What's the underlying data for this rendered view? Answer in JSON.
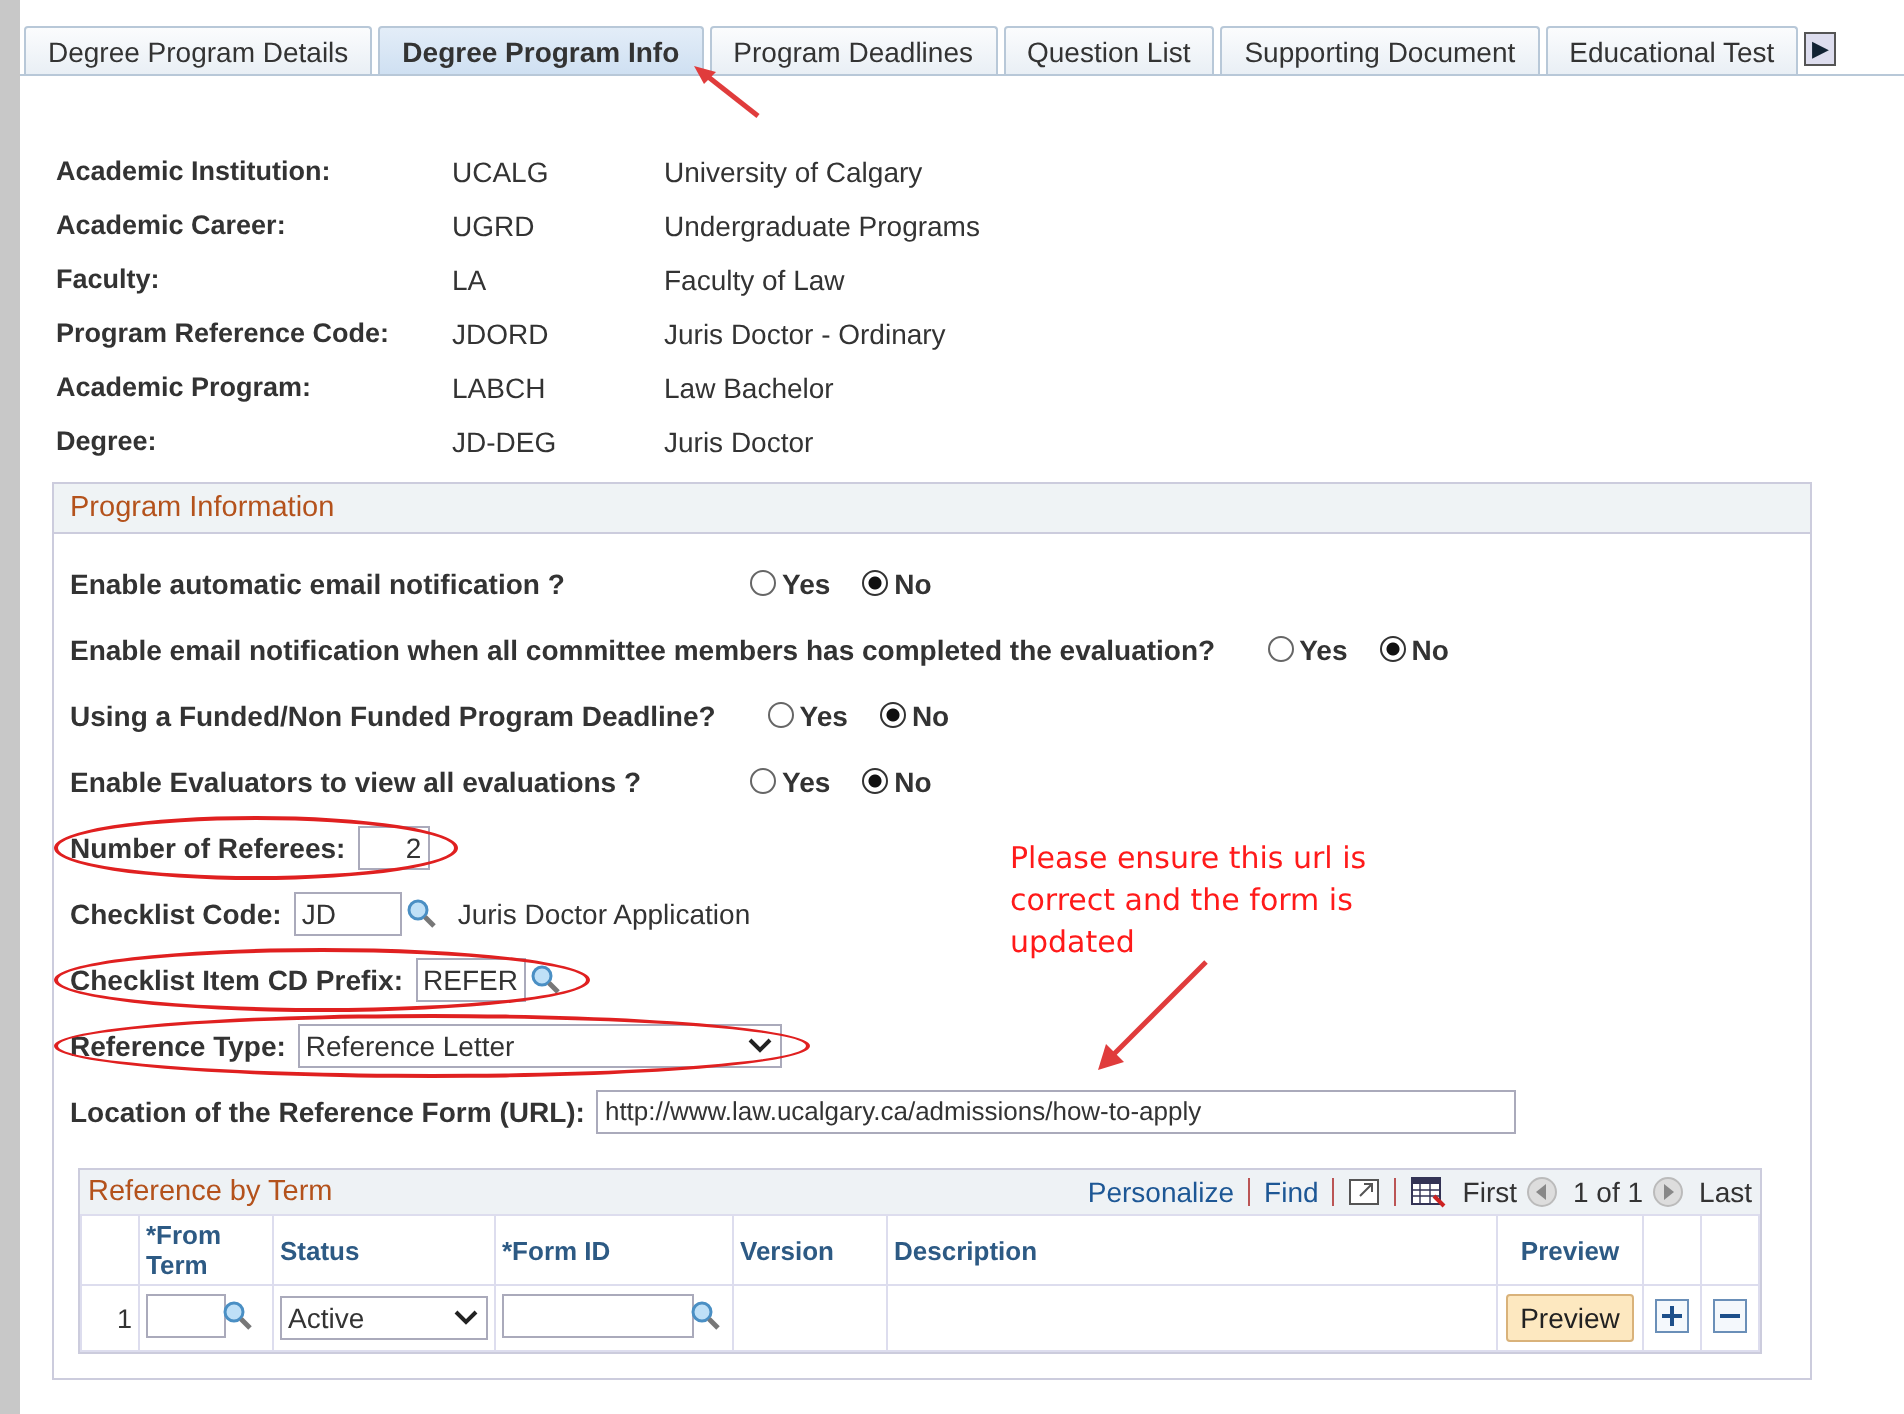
{
  "tabs": [
    {
      "label": "Degree Program Details",
      "selected": false
    },
    {
      "label": "Degree Program Info",
      "selected": true
    },
    {
      "label": "Program Deadlines",
      "selected": false
    },
    {
      "label": "Question List",
      "selected": false
    },
    {
      "label": "Supporting Document",
      "selected": false
    },
    {
      "label": "Educational Test",
      "selected": false
    }
  ],
  "tab_scroll": "▶",
  "details": [
    {
      "label": "Academic Institution:",
      "code": "UCALG",
      "description": "University of Calgary"
    },
    {
      "label": "Academic Career:",
      "code": "UGRD",
      "description": "Undergraduate Programs"
    },
    {
      "label": "Faculty:",
      "code": "LA",
      "description": "Faculty of Law"
    },
    {
      "label": "Program Reference Code:",
      "code": "JDORD",
      "description": "Juris Doctor - Ordinary"
    },
    {
      "label": "Academic Program:",
      "code": "LABCH",
      "description": "Law Bachelor"
    },
    {
      "label": "Degree:",
      "code": "JD-DEG",
      "description": "Juris Doctor"
    }
  ],
  "program_information": {
    "title": "Program Information",
    "fields": [
      {
        "kind": "radio",
        "label": "Enable automatic email notification ?",
        "circled": false,
        "options": [
          {
            "label": "Yes",
            "selected": false
          },
          {
            "label": "No",
            "selected": true
          }
        ]
      },
      {
        "kind": "radio",
        "label": "Enable email notification when all committee members has completed the evaluation?",
        "circled": false,
        "options": [
          {
            "label": "Yes",
            "selected": false
          },
          {
            "label": "No",
            "selected": true
          }
        ]
      },
      {
        "kind": "radio",
        "label": "Using a Funded/Non Funded Program Deadline?",
        "circled": false,
        "options": [
          {
            "label": "Yes",
            "selected": false
          },
          {
            "label": "No",
            "selected": true
          }
        ]
      },
      {
        "kind": "radio",
        "label": "Enable Evaluators to view all evaluations ?",
        "circled": false,
        "options": [
          {
            "label": "Yes",
            "selected": false
          },
          {
            "label": "No",
            "selected": true
          }
        ]
      },
      {
        "kind": "number",
        "label": "Number of Referees:",
        "value": "2",
        "circled": true
      },
      {
        "kind": "lookup",
        "label": "Checklist Code:",
        "value": "JD",
        "description": "Juris Doctor Application",
        "circled": false
      },
      {
        "kind": "lookup",
        "label": "Checklist Item CD Prefix:",
        "value": "REFER",
        "circled": true
      },
      {
        "kind": "select",
        "label": "Reference Type:",
        "value": "Reference Letter",
        "circled": true
      },
      {
        "kind": "url",
        "label": "Location of the Reference Form (URL):",
        "value": "http://www.law.ucalgary.ca/admissions/how-to-apply",
        "circled": false
      }
    ],
    "note": "Please ensure this url is correct and the form is updated",
    "grid": {
      "title": "Reference by Term",
      "links": [
        "Personalize",
        "Find"
      ],
      "nav": {
        "first": "First",
        "count": "1 of 1",
        "last": "Last"
      },
      "columns": [
        "*From Term",
        "Status",
        "*Form ID",
        "Version",
        "Description",
        "Preview"
      ],
      "rows": [
        {
          "number": "1",
          "from_term": "",
          "status": "Active",
          "form_id": "",
          "version": "",
          "description": "",
          "preview": "Preview"
        }
      ]
    }
  }
}
